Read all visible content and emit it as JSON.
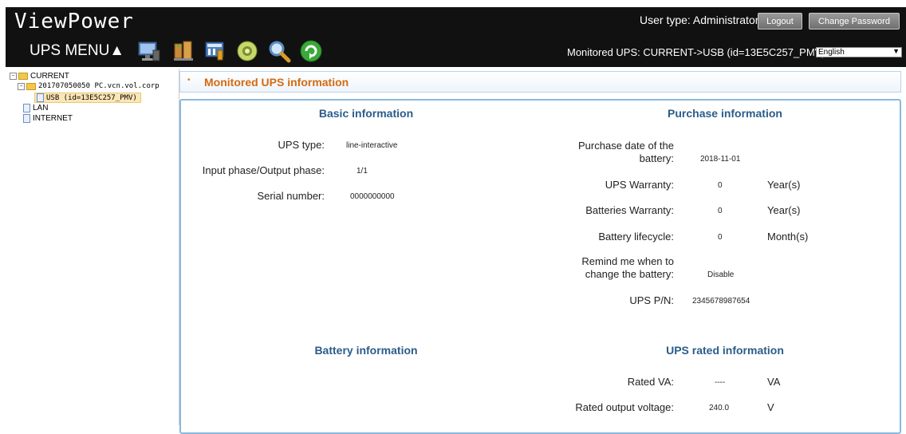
{
  "header": {
    "brand": "ViewPower",
    "menu_label": "UPS MENU▲",
    "user_type": "User type: Administrator",
    "logout": "Logout",
    "change_password": "Change Password",
    "monitored": "Monitored UPS: CURRENT->USB (id=13E5C257_PMV)",
    "language": "English",
    "icons": [
      "monitor-icon",
      "network-icon",
      "config-icon",
      "control-icon",
      "search-icon",
      "refresh-icon"
    ]
  },
  "tree": {
    "current": "CURRENT",
    "host": "201707050050 PC.vcn.vol.corp",
    "usb": "USB (id=13E5C257_PMV)",
    "lan": "LAN",
    "internet": "INTERNET"
  },
  "section": {
    "title": "Monitored UPS information"
  },
  "basic": {
    "title": "Basic information",
    "ups_type_label": "UPS type:",
    "ups_type": "line-interactive",
    "phase_label": "Input phase/Output phase:",
    "phase": "1/1",
    "serial_label": "Serial number:",
    "serial": "0000000000"
  },
  "purchase": {
    "title": "Purchase information",
    "date_label_1": "Purchase date of the",
    "date_label_2": "battery:",
    "date": "2018-11-01",
    "ups_warranty_label": "UPS Warranty:",
    "ups_warranty": "0",
    "ups_warranty_unit": "Year(s)",
    "batt_warranty_label": "Batteries Warranty:",
    "batt_warranty": "0",
    "batt_warranty_unit": "Year(s)",
    "lifecycle_label": "Battery lifecycle:",
    "lifecycle": "0",
    "lifecycle_unit": "Month(s)",
    "remind_label_1": "Remind me when to",
    "remind_label_2": "change the battery:",
    "remind": "Disable",
    "pn_label": "UPS P/N:",
    "pn": "2345678987654"
  },
  "battery": {
    "title": "Battery information"
  },
  "rated": {
    "title": "UPS rated information",
    "va_label": "Rated VA:",
    "va": "----",
    "va_unit": "VA",
    "voltage_label": "Rated output voltage:",
    "voltage": "240.0",
    "voltage_unit": "V"
  }
}
